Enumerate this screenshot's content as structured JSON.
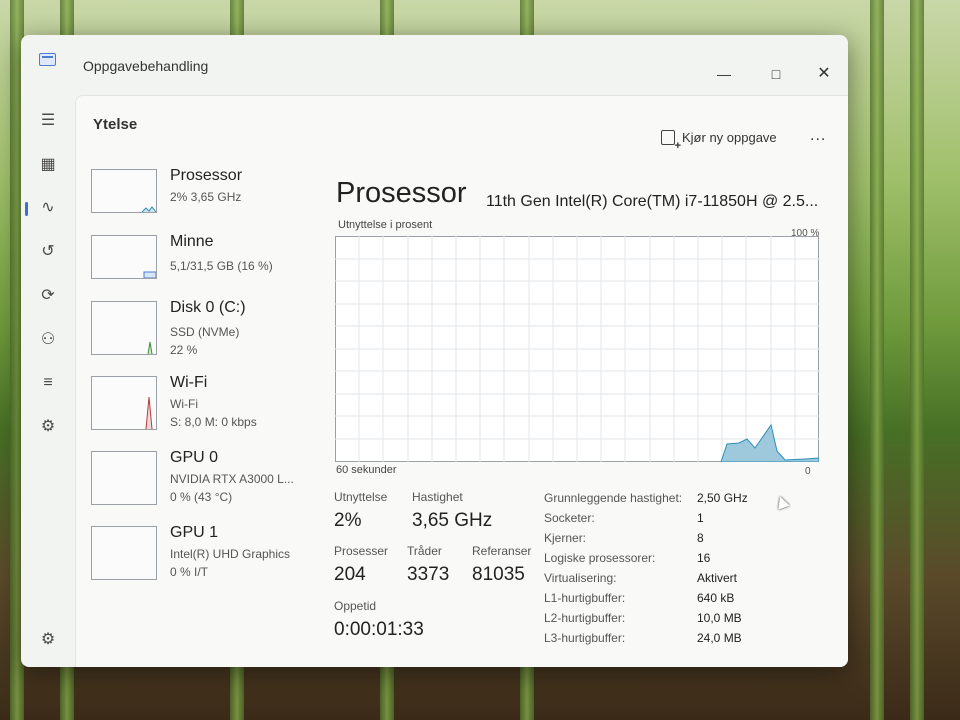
{
  "window": {
    "title": "Oppgavebehandling"
  },
  "page": {
    "title": "Ytelse",
    "new_task_label": "Kjør ny oppgave",
    "more_label": "..."
  },
  "resources": [
    {
      "name": "Prosessor",
      "sub1": "2% 3,65 GHz",
      "sub2": ""
    },
    {
      "name": "Minne",
      "sub1": "5,1/31,5 GB (16 %)",
      "sub2": ""
    },
    {
      "name": "Disk 0 (C:)",
      "sub1": "SSD (NVMe)",
      "sub2": "22 %"
    },
    {
      "name": "Wi-Fi",
      "sub1": "Wi-Fi",
      "sub2": "S: 8,0 M: 0 kbps"
    },
    {
      "name": "GPU 0",
      "sub1": "NVIDIA RTX A3000 L...",
      "sub2": "0 % (43 °C)"
    },
    {
      "name": "GPU 1",
      "sub1": "Intel(R) UHD Graphics",
      "sub2": "0 % I/T"
    }
  ],
  "detail": {
    "title": "Prosessor",
    "model": "11th Gen Intel(R) Core(TM) i7-11850H @ 2.5...",
    "graph_label": "Utnyttelse i prosent",
    "graph_max": "100 %",
    "graph_time": "60 sekunder",
    "graph_min": "0"
  },
  "stats": {
    "utilization_label": "Utnyttelse",
    "utilization": "2%",
    "speed_label": "Hastighet",
    "speed": "3,65 GHz",
    "processes_label": "Prosesser",
    "processes": "204",
    "threads_label": "Tråder",
    "threads": "3373",
    "handles_label": "Referanser",
    "handles": "81035",
    "uptime_label": "Oppetid",
    "uptime": "0:00:01:33"
  },
  "specs": [
    {
      "label": "Grunnleggende hastighet:",
      "value": "2,50 GHz"
    },
    {
      "label": "Socketer:",
      "value": "1"
    },
    {
      "label": "Kjerner:",
      "value": "8"
    },
    {
      "label": "Logiske prosessorer:",
      "value": "16"
    },
    {
      "label": "Virtualisering:",
      "value": "Aktivert"
    },
    {
      "label": "L1-hurtigbuffer:",
      "value": "640 kB"
    },
    {
      "label": "L2-hurtigbuffer:",
      "value": "10,0 MB"
    },
    {
      "label": "L3-hurtigbuffer:",
      "value": "24,0 MB"
    }
  ],
  "colors": {
    "accent": "#3c6fd8",
    "graph_fill": "#9ec9dc",
    "graph_line": "#2f8fb8",
    "graph_grid": "#e2e6ea"
  },
  "icons": {
    "nav": [
      "hamburger-icon",
      "processes-icon",
      "performance-icon",
      "app-history-icon",
      "startup-apps-icon",
      "users-icon",
      "details-icon",
      "services-icon",
      "settings-icon"
    ]
  }
}
